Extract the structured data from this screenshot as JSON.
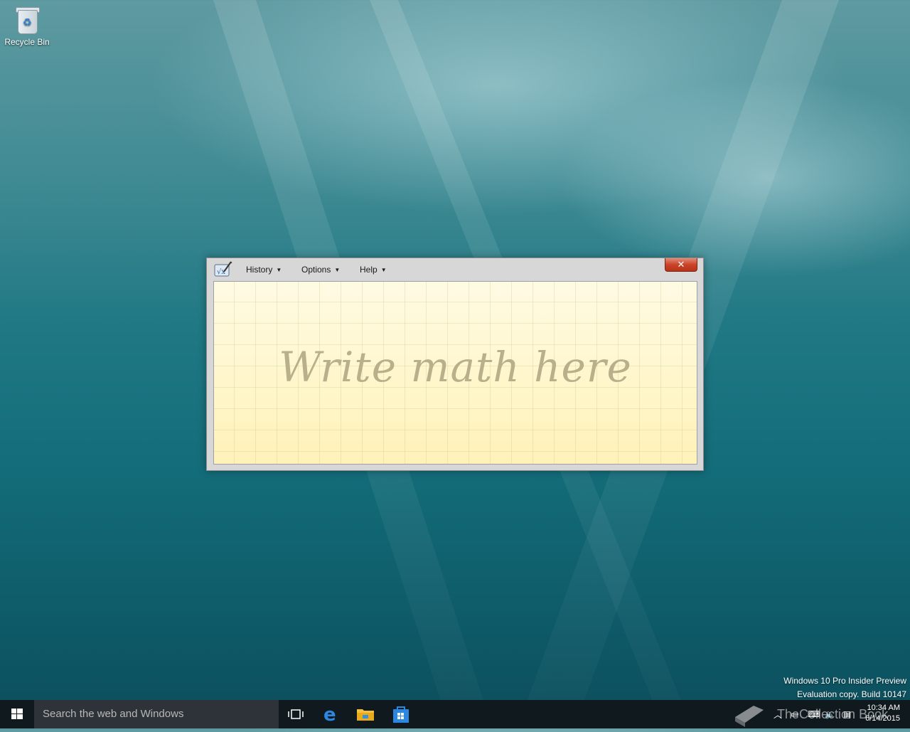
{
  "desktop": {
    "icons": [
      {
        "label": "Recycle Bin",
        "icon": "recycle-bin-icon"
      }
    ]
  },
  "window": {
    "app": "Math Input Panel",
    "menus": [
      {
        "label": "History"
      },
      {
        "label": "Options"
      },
      {
        "label": "Help"
      }
    ],
    "close_label": "✕",
    "writing_area": {
      "placeholder": "Write math here"
    }
  },
  "watermark": {
    "line1": "Windows 10 Pro Insider Preview",
    "line2": "Evaluation copy. Build 10147"
  },
  "taskbar": {
    "search_placeholder": "Search the web and Windows",
    "pinned": [
      "task-view-icon",
      "edge-icon",
      "file-explorer-icon",
      "store-icon"
    ],
    "tray_icons": [
      "chevron-up-icon",
      "network-icon",
      "volume-icon",
      "action-center-icon"
    ],
    "time": "10:34 AM",
    "date": "6/14/2015",
    "brand_overlay": "TheCollection Book"
  },
  "colors": {
    "taskbar": "#10191d",
    "search_box": "#2d3338",
    "writing_paper": "#fff6c2",
    "close_button": "#c9442a"
  }
}
